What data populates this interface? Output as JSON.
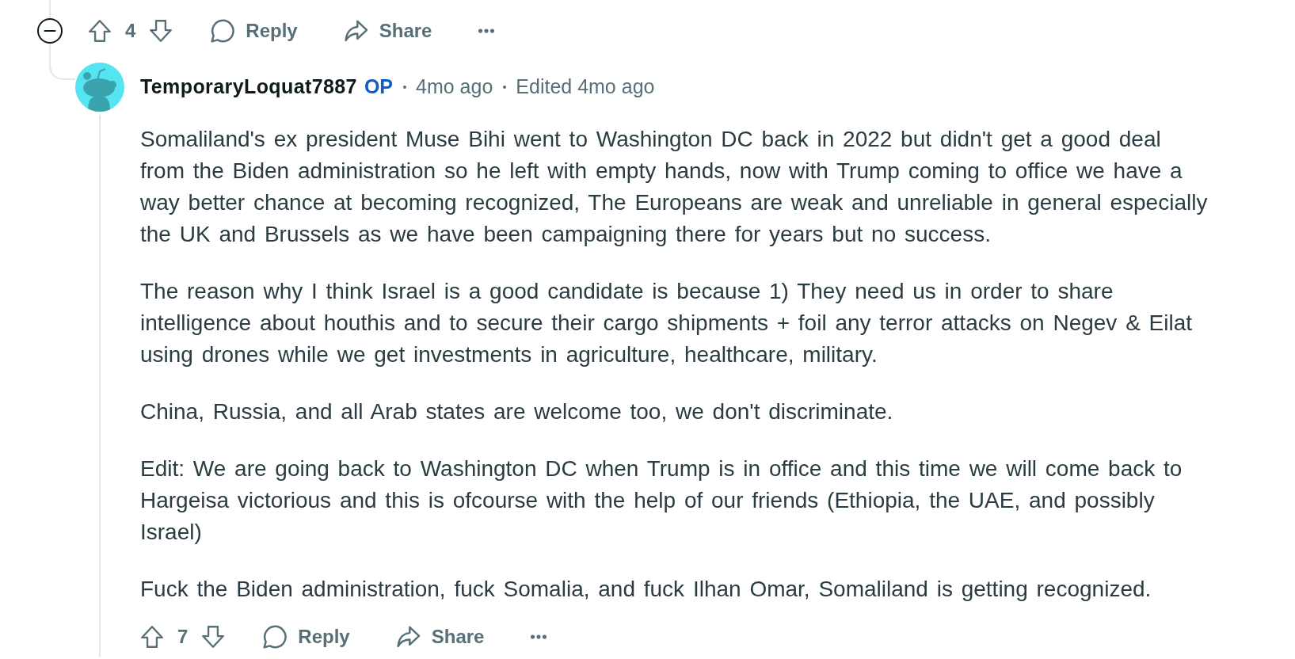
{
  "parent_comment": {
    "expanded": true,
    "actions": {
      "vote_count": "4",
      "reply": "Reply",
      "share": "Share"
    }
  },
  "reply_comment": {
    "author": "TemporaryLoquat7887",
    "author_badge": "OP",
    "posted": "4mo ago",
    "edited": "Edited 4mo ago",
    "body": [
      "Somaliland's ex president Muse Bihi went to Washington DC back in 2022 but didn't get a good deal from the Biden administration so he left with empty hands, now with Trump coming to office we have a way better chance at becoming recognized, The Europeans are weak and unreliable in general especially the UK and Brussels as we have been campaigning there for years but no success.",
      "The reason why I think Israel is a good candidate is because 1) They need us in order to share intelligence about houthis and to secure their cargo shipments + foil any terror attacks on Negev & Eilat using drones while we get investments in agriculture, healthcare, military.",
      "China, Russia, and all Arab states are welcome too, we don't discriminate.",
      "Edit: We are going back to Washington DC when Trump is in office and this time we will come back to Hargeisa victorious and this is ofcourse with the help of our friends (Ethiopia, the UAE, and possibly Israel)",
      "Fuck the Biden administration, fuck Somalia, and fuck Ilhan Omar, Somaliland is getting recognized."
    ],
    "actions": {
      "vote_count": "7",
      "reply": "Reply",
      "share": "Share"
    }
  }
}
